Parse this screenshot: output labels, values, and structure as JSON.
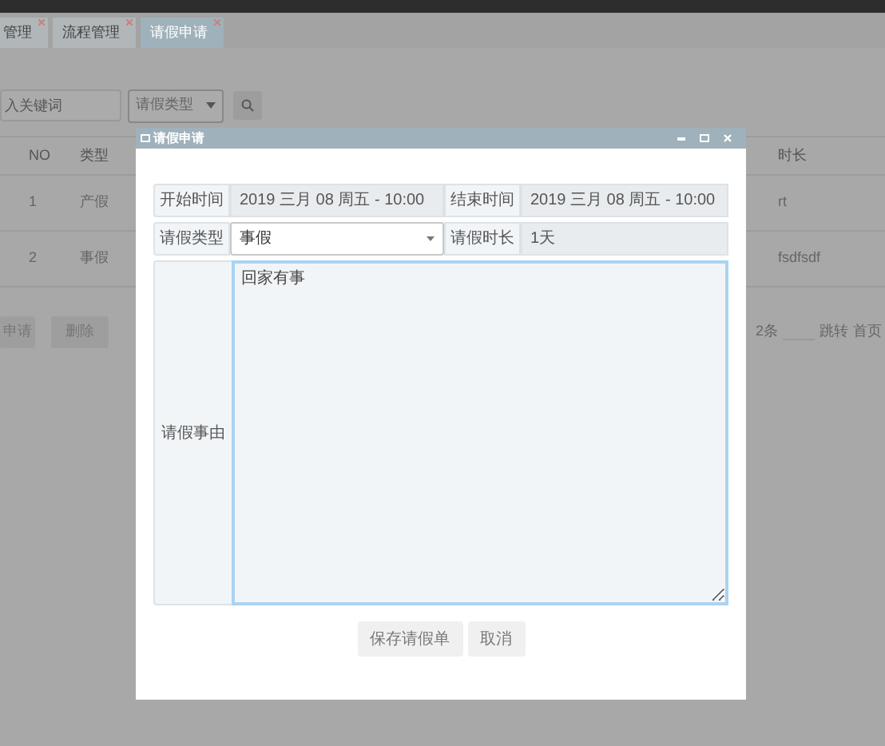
{
  "tabs": [
    {
      "label": "管理",
      "selected": false
    },
    {
      "label": "流程管理",
      "selected": false
    },
    {
      "label": "请假申请",
      "selected": true
    }
  ],
  "toolbar": {
    "search_placeholder": "入关键词",
    "type_select": "请假类型"
  },
  "table": {
    "columns": [
      "NO",
      "类型",
      "时长"
    ],
    "rows": [
      {
        "no": "1",
        "type": "产假",
        "duration": "rt"
      },
      {
        "no": "2",
        "type": "事假",
        "duration": "fsdfsdf"
      }
    ]
  },
  "actions": [
    "申请",
    "删除"
  ],
  "pagination": {
    "total": "2条",
    "jump": "跳转",
    "first": "首页"
  },
  "dialog": {
    "title": "请假申请",
    "fields": [
      {
        "label": "开始时间",
        "value": "2019 三月 08 周五 - 10:00",
        "kind": "readonly"
      },
      {
        "label": "结束时间",
        "value": "2019 三月 08 周五 - 10:00",
        "kind": "readonly"
      },
      {
        "label": "请假类型",
        "value": "事假",
        "kind": "select"
      },
      {
        "label": "请假时长",
        "value": "1天",
        "kind": "readonly"
      }
    ],
    "reason": {
      "label": "请假事由",
      "value": "回家有事"
    },
    "buttons": [
      "保存请假单",
      "取消"
    ]
  }
}
